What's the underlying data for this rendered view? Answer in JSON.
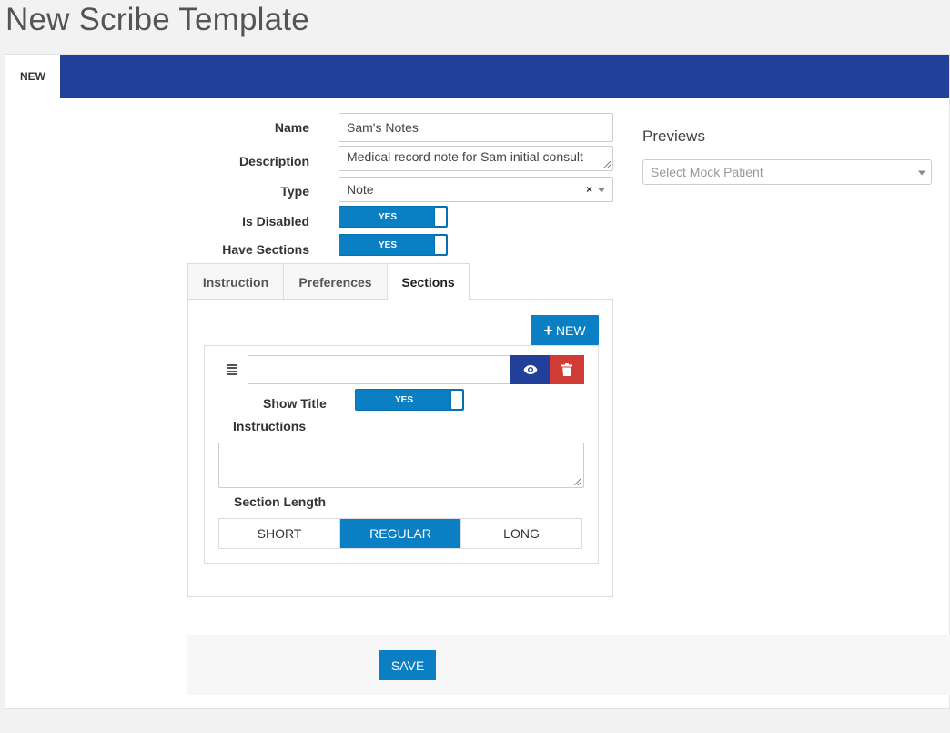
{
  "page": {
    "title": "New Scribe Template"
  },
  "tabs": {
    "new_label": "NEW"
  },
  "colors": {
    "primary": "#0a7fc4",
    "navy": "#22409a",
    "danger": "#d03b35"
  },
  "form": {
    "name_label": "Name",
    "name_value": "Sam's Notes",
    "description_label": "Description",
    "description_value": "Medical record note for Sam initial consult",
    "type_label": "Type",
    "type_value": "Note",
    "type_clear": "×",
    "is_disabled_label": "Is Disabled",
    "is_disabled_value": "YES",
    "have_sections_label": "Have Sections",
    "have_sections_value": "YES"
  },
  "previews": {
    "title": "Previews",
    "select_placeholder": "Select Mock Patient"
  },
  "subtabs": [
    {
      "label": "Instruction",
      "active": false
    },
    {
      "label": "Preferences",
      "active": false
    },
    {
      "label": "Sections",
      "active": true
    }
  ],
  "sections": {
    "new_button_label": "NEW",
    "new_button_icon": "plus-icon",
    "card": {
      "drag_icon": "drag-handle-icon",
      "title_value": "",
      "preview_icon": "eye-icon",
      "delete_icon": "trash-icon",
      "show_title_label": "Show Title",
      "show_title_value": "YES",
      "instructions_label": "Instructions",
      "instructions_value": "",
      "length_label": "Section Length",
      "length_options": [
        "SHORT",
        "REGULAR",
        "LONG"
      ],
      "length_selected": "REGULAR"
    }
  },
  "footer": {
    "save_label": "SAVE"
  }
}
